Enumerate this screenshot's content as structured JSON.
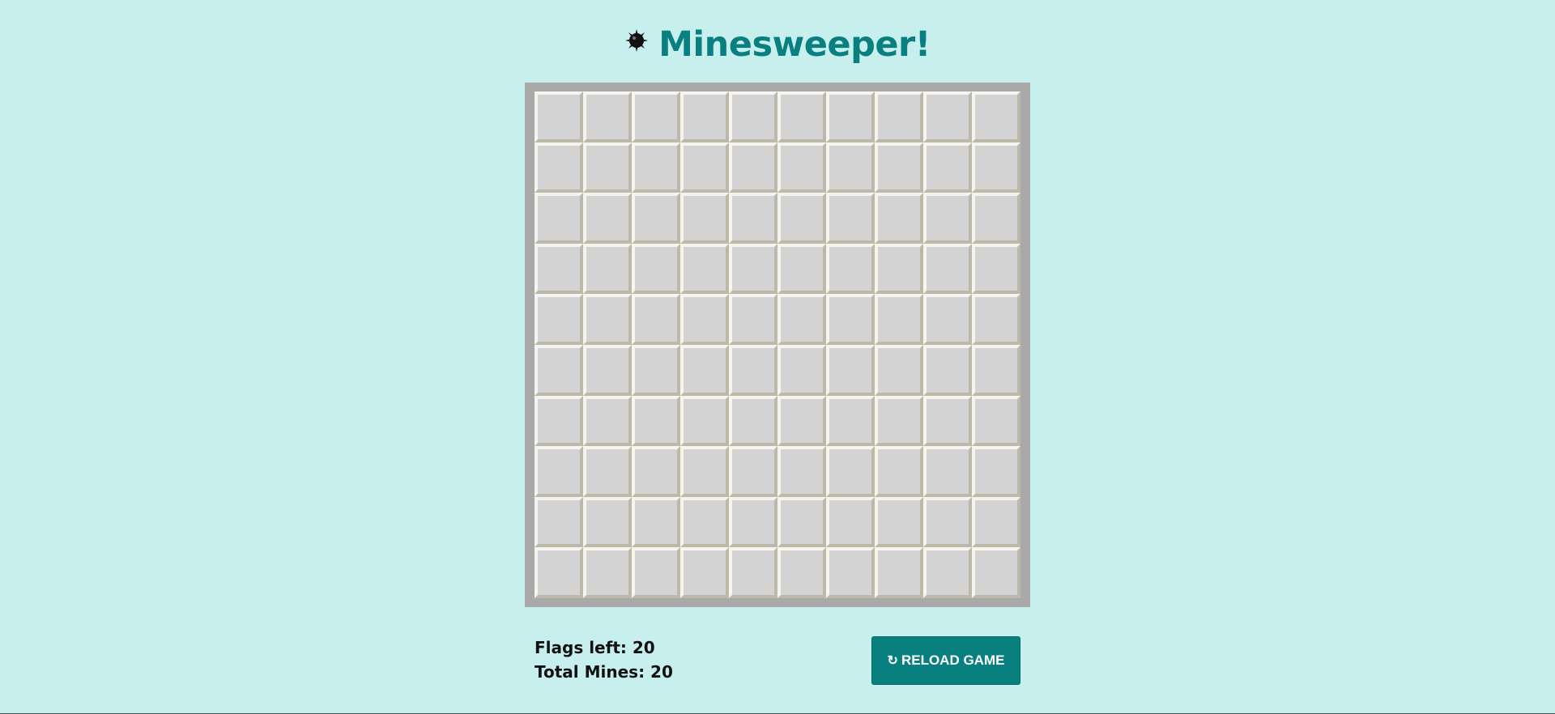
{
  "header": {
    "icon": "bomb-icon",
    "title": "Minesweeper!"
  },
  "board": {
    "rows": 10,
    "cols": 10,
    "cell_state": "unrevealed"
  },
  "stats": {
    "flags_label": "Flags left: 20",
    "mines_label": "Total Mines: 20"
  },
  "reload_button": {
    "icon": "refresh-icon",
    "icon_glyph": "↻",
    "label": "RELOAD GAME"
  },
  "colors": {
    "background": "#c6efee",
    "accent": "#0a7f7f",
    "button": "#098080",
    "board_frame": "#a9a9a9",
    "cell": "#d3d3d3"
  }
}
